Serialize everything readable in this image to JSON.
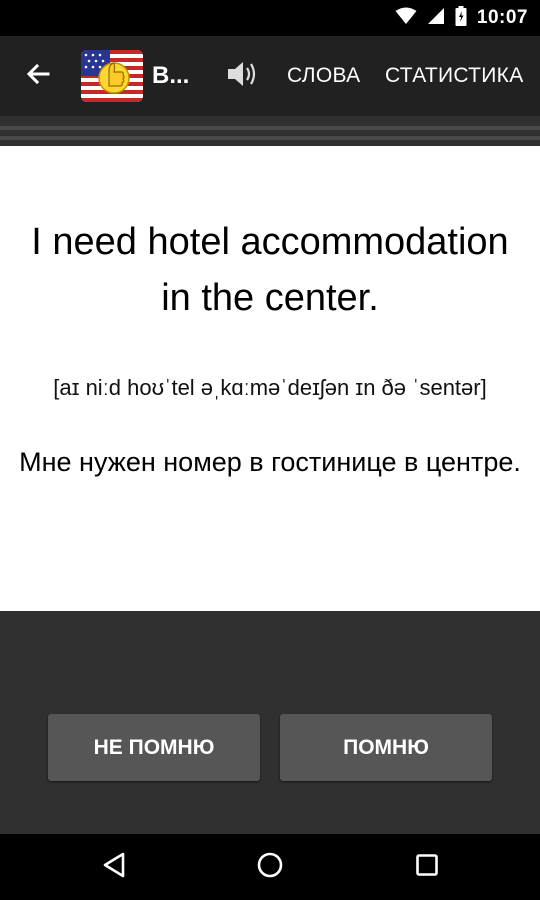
{
  "status_bar": {
    "time": "10:07",
    "icons": [
      "wifi-icon",
      "cell-signal-icon",
      "battery-icon"
    ]
  },
  "action_bar": {
    "title": "В...",
    "back_icon": "arrow-back-icon",
    "logo_icon": "us-flag-thumbs-up-logo",
    "speaker_icon": "speaker-icon",
    "menu": {
      "words": "СЛОВА",
      "statistics": "СТАТИСТИКА"
    }
  },
  "card": {
    "phrase_en": "I need hotel accommodation in the center.",
    "transcription": "[aɪ niːd hoʊˈtel əˌkɑːməˈdeɪʃən ɪn ðə ˈsentər]",
    "phrase_ru": "Мне нужен номер в гостинице в центре."
  },
  "buttons": {
    "forgot": "НЕ ПОМНЮ",
    "remember": "ПОМНЮ"
  },
  "nav_bar": {
    "icons": [
      "nav-back-icon",
      "nav-home-icon",
      "nav-recents-icon"
    ]
  },
  "colors": {
    "action_bar": "#212121",
    "background": "#303030",
    "card": "#ffffff",
    "button": "#565656"
  }
}
